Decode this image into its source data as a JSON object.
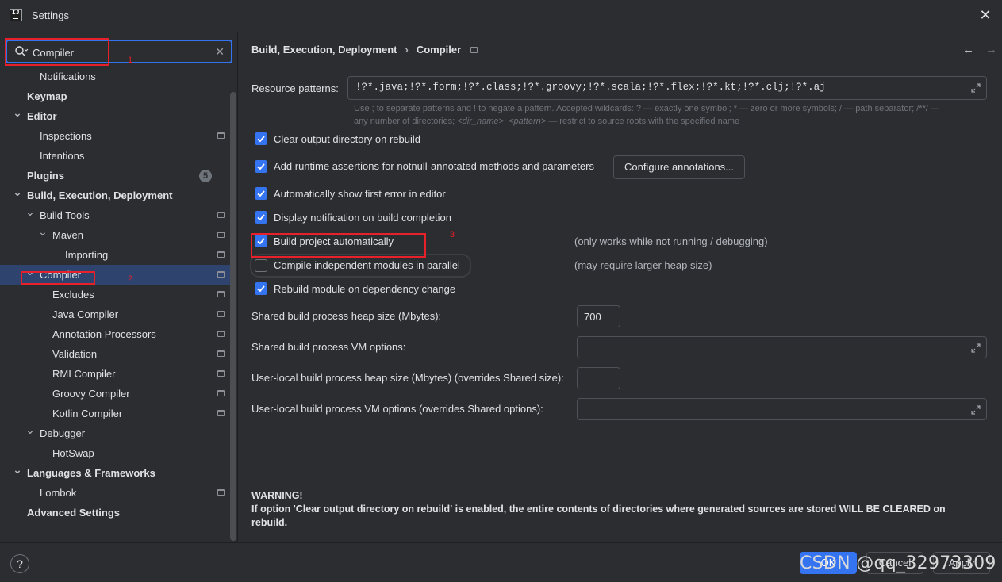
{
  "window": {
    "title": "Settings"
  },
  "search": {
    "value": "Compiler"
  },
  "sidebar": {
    "items": [
      {
        "label": "Notifications",
        "bold": false,
        "level": 2,
        "chevron": "",
        "page_icon": false,
        "selected": false
      },
      {
        "label": "Keymap",
        "bold": true,
        "level": 1,
        "chevron": "",
        "page_icon": false,
        "selected": false
      },
      {
        "label": "Editor",
        "bold": true,
        "level": 1,
        "chevron": "down",
        "page_icon": false,
        "selected": false
      },
      {
        "label": "Inspections",
        "bold": false,
        "level": 2,
        "chevron": "",
        "page_icon": true,
        "selected": false
      },
      {
        "label": "Intentions",
        "bold": false,
        "level": 2,
        "chevron": "",
        "page_icon": false,
        "selected": false
      },
      {
        "label": "Plugins",
        "bold": true,
        "level": 1,
        "chevron": "",
        "page_icon": false,
        "selected": false,
        "badge": "5"
      },
      {
        "label": "Build, Execution, Deployment",
        "bold": true,
        "level": 1,
        "chevron": "down",
        "page_icon": false,
        "selected": false
      },
      {
        "label": "Build Tools",
        "bold": false,
        "level": 2,
        "chevron": "down",
        "page_icon": true,
        "selected": false
      },
      {
        "label": "Maven",
        "bold": false,
        "level": 3,
        "chevron": "down",
        "page_icon": true,
        "selected": false
      },
      {
        "label": "Importing",
        "bold": false,
        "level": 4,
        "chevron": "",
        "page_icon": true,
        "selected": false
      },
      {
        "label": "Compiler",
        "bold": false,
        "level": 2,
        "chevron": "down",
        "page_icon": true,
        "selected": true
      },
      {
        "label": "Excludes",
        "bold": false,
        "level": 3,
        "chevron": "",
        "page_icon": true,
        "selected": false
      },
      {
        "label": "Java Compiler",
        "bold": false,
        "level": 3,
        "chevron": "",
        "page_icon": true,
        "selected": false
      },
      {
        "label": "Annotation Processors",
        "bold": false,
        "level": 3,
        "chevron": "",
        "page_icon": true,
        "selected": false
      },
      {
        "label": "Validation",
        "bold": false,
        "level": 3,
        "chevron": "",
        "page_icon": true,
        "selected": false
      },
      {
        "label": "RMI Compiler",
        "bold": false,
        "level": 3,
        "chevron": "",
        "page_icon": true,
        "selected": false
      },
      {
        "label": "Groovy Compiler",
        "bold": false,
        "level": 3,
        "chevron": "",
        "page_icon": true,
        "selected": false
      },
      {
        "label": "Kotlin Compiler",
        "bold": false,
        "level": 3,
        "chevron": "",
        "page_icon": true,
        "selected": false
      },
      {
        "label": "Debugger",
        "bold": false,
        "level": 2,
        "chevron": "down",
        "page_icon": false,
        "selected": false
      },
      {
        "label": "HotSwap",
        "bold": false,
        "level": 3,
        "chevron": "",
        "page_icon": false,
        "selected": false
      },
      {
        "label": "Languages & Frameworks",
        "bold": true,
        "level": 1,
        "chevron": "down",
        "page_icon": false,
        "selected": false
      },
      {
        "label": "Lombok",
        "bold": false,
        "level": 2,
        "chevron": "",
        "page_icon": true,
        "selected": false
      },
      {
        "label": "Advanced Settings",
        "bold": true,
        "level": 1,
        "chevron": "",
        "page_icon": false,
        "selected": false
      }
    ]
  },
  "breadcrumb": {
    "parent": "Build, Execution, Deployment",
    "sep": "›",
    "current": "Compiler"
  },
  "resource": {
    "label": "Resource patterns:",
    "value": "!?*.java;!?*.form;!?*.class;!?*.groovy;!?*.scala;!?*.flex;!?*.kt;!?*.clj;!?*.aj",
    "hint_line1": "Use ; to separate patterns and ! to negate a pattern. Accepted wildcards: ? — exactly one symbol; * — zero or more symbols; / — path separator; /**/ —",
    "hint_line2_a": "any number of directories; ",
    "hint_line2_b": "<dir_name>",
    "hint_line2_c": ": ",
    "hint_line2_d": "<pattern>",
    "hint_line2_e": " — restrict to source roots with the specified name"
  },
  "options": {
    "clear_output": {
      "label": "Clear output directory on rebuild",
      "checked": true
    },
    "runtime_assertions": {
      "label": "Add runtime assertions for notnull-annotated methods and parameters",
      "checked": true,
      "button": "Configure annotations..."
    },
    "show_first_error": {
      "label": "Automatically show first error in editor",
      "checked": true
    },
    "display_notification": {
      "label": "Display notification on build completion",
      "checked": true
    },
    "build_auto": {
      "label": "Build project automatically",
      "checked": true,
      "note": "(only works while not running / debugging)"
    },
    "compile_parallel": {
      "label": "Compile independent modules in parallel",
      "checked": false,
      "note": "(may require larger heap size)"
    },
    "rebuild_dependency": {
      "label": "Rebuild module on dependency change",
      "checked": true
    }
  },
  "fields": {
    "heap_size": {
      "label": "Shared build process heap size (Mbytes):",
      "value": "700"
    },
    "vm_options": {
      "label": "Shared build process VM options:",
      "value": ""
    },
    "user_heap": {
      "label": "User-local build process heap size (Mbytes) (overrides Shared size):",
      "value": ""
    },
    "user_vm": {
      "label": "User-local build process VM options (overrides Shared options):",
      "value": ""
    }
  },
  "warning": {
    "title": "WARNING!",
    "text": "If option 'Clear output directory on rebuild' is enabled, the entire contents of directories where generated sources are stored WILL BE CLEARED on rebuild."
  },
  "annotations": {
    "one": "1",
    "two": "2",
    "three": "3"
  },
  "footer": {
    "help": "?",
    "ok": "OK",
    "cancel": "Cancel",
    "apply": "Apply",
    "watermark": "CSDN @qq_32973309"
  },
  "colors": {
    "accent": "#3574f0",
    "selection": "#2e436e",
    "annotation": "#e8202a",
    "background": "#2b2d30"
  }
}
